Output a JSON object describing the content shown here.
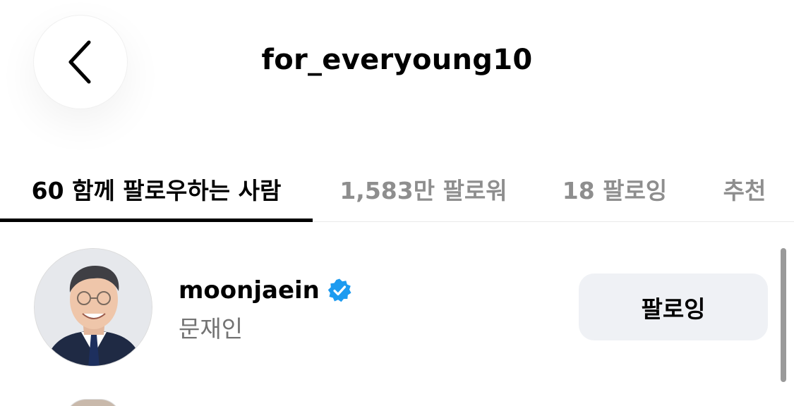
{
  "header": {
    "title": "for_everyoung10",
    "back_icon": "chevron-left-icon"
  },
  "tabs": [
    {
      "label": "60 함께 팔로우하는 사람",
      "active": true
    },
    {
      "label": "1,583만 팔로워",
      "active": false
    },
    {
      "label": "18 팔로잉",
      "active": false
    },
    {
      "label": "추천",
      "active": false
    }
  ],
  "list": {
    "items": [
      {
        "username": "moonjaein",
        "full_name": "문재인",
        "verified": true,
        "verified_icon": "verified-badge-icon",
        "button_label": "팔로잉"
      }
    ]
  },
  "colors": {
    "verified_blue": "#1d9bf0",
    "button_bg": "#eff1f5",
    "inactive_tab": "#8e8e8e",
    "secondary_text": "#737373"
  }
}
